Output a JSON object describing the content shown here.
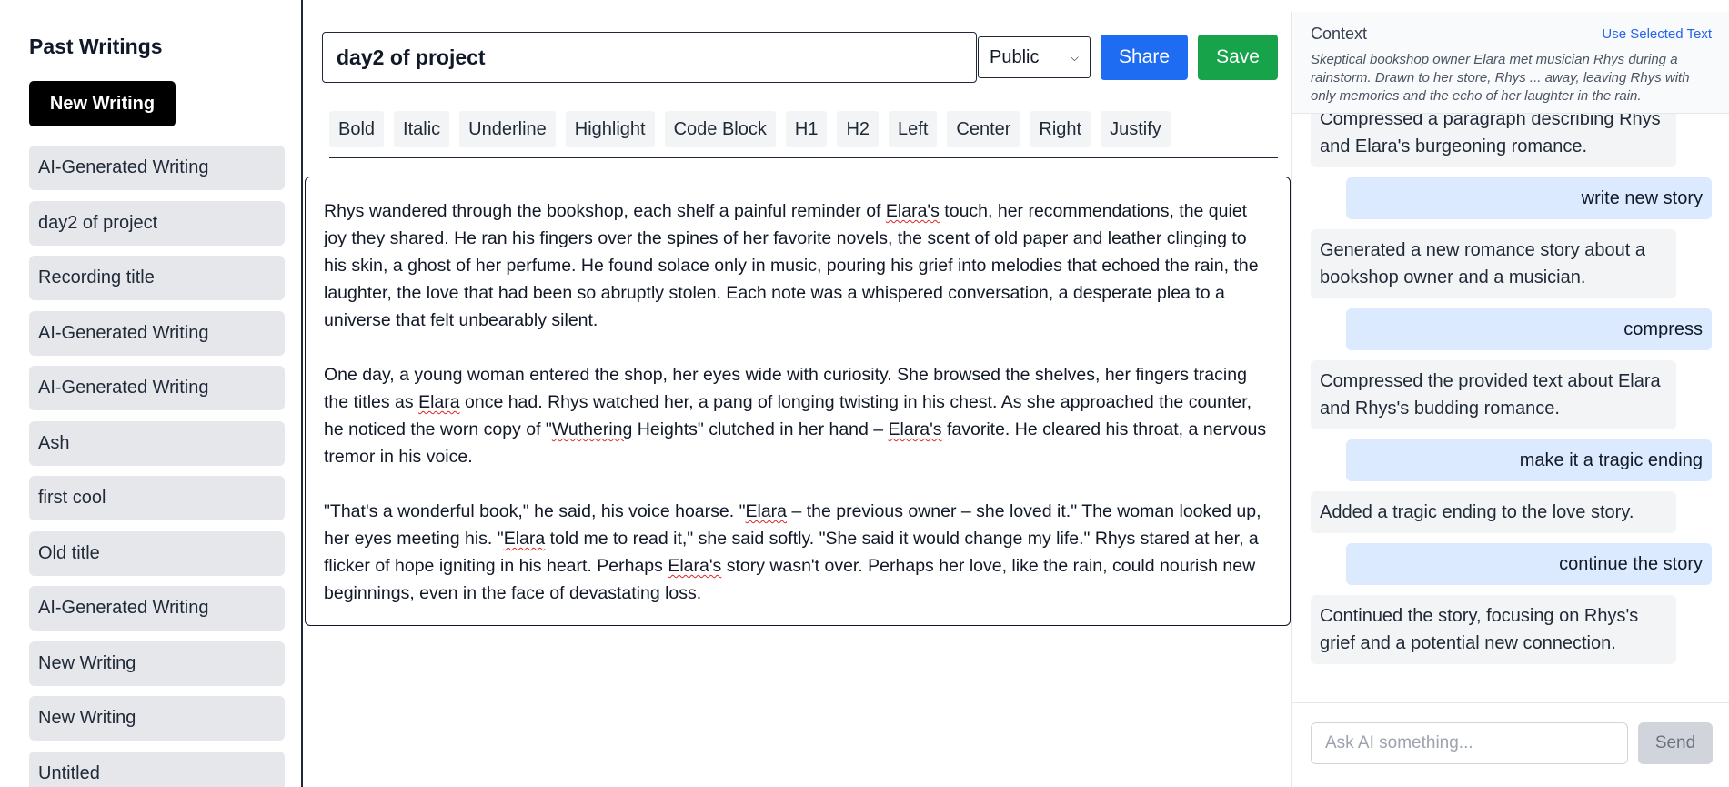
{
  "sidebar": {
    "title": "Past Writings",
    "new_button": "New Writing",
    "items": [
      {
        "label": "AI-Generated Writing"
      },
      {
        "label": "day2 of project"
      },
      {
        "label": "Recording title"
      },
      {
        "label": "AI-Generated Writing"
      },
      {
        "label": "AI-Generated Writing"
      },
      {
        "label": "Ash"
      },
      {
        "label": "first cool"
      },
      {
        "label": "Old title"
      },
      {
        "label": "AI-Generated Writing"
      },
      {
        "label": "New Writing"
      },
      {
        "label": "New Writing"
      },
      {
        "label": "Untitled"
      }
    ]
  },
  "editor": {
    "title_value": "day2 of project",
    "visibility": "Public",
    "share_label": "Share",
    "save_label": "Save",
    "toolbar": [
      "Bold",
      "Italic",
      "Underline",
      "Highlight",
      "Code Block",
      "H1",
      "H2",
      "Left",
      "Center",
      "Right",
      "Justify"
    ],
    "paragraphs": [
      [
        {
          "t": "Rhys wandered through the bookshop, each shelf a painful reminder of "
        },
        {
          "t": "Elara's",
          "s": true
        },
        {
          "t": " touch, her recommendations, the quiet joy they shared. He ran his fingers over the spines of her favorite novels, the scent of old paper and leather clinging to his skin, a ghost of her perfume. He found solace only in music, pouring his grief into melodies that echoed the rain, the laughter, the love that had been so abruptly stolen. Each note was a whispered conversation, a desperate plea to a universe that felt unbearably silent."
        }
      ],
      [
        {
          "t": "One day, a young woman entered the shop, her eyes wide with curiosity. She browsed the shelves, her fingers tracing the titles as "
        },
        {
          "t": "Elara",
          "s": true
        },
        {
          "t": " once had. Rhys watched her, a pang of longing twisting in his chest. As she approached the counter, he noticed the worn copy of \""
        },
        {
          "t": "Wuthering",
          "s": true
        },
        {
          "t": " Heights\" clutched in her hand – "
        },
        {
          "t": "Elara's",
          "s": true
        },
        {
          "t": " favorite. He cleared his throat, a nervous tremor in his voice."
        }
      ],
      [
        {
          "t": "\"That's a wonderful book,\" he said, his voice hoarse. \""
        },
        {
          "t": "Elara",
          "s": true
        },
        {
          "t": " – the previous owner – she loved it.\" The woman looked up, her eyes meeting his. \""
        },
        {
          "t": "Elara",
          "s": true
        },
        {
          "t": " told me to read it,\" she said softly. \"She said it would change my life.\" Rhys stared at her, a flicker of hope igniting in his heart. Perhaps "
        },
        {
          "t": "Elara's",
          "s": true
        },
        {
          "t": " story wasn't over. Perhaps her love, like the rain, could nourish new beginnings, even in the face of devastating loss."
        }
      ]
    ]
  },
  "chat": {
    "context_title": "Context",
    "use_selected_label": "Use Selected Text",
    "context_text": "Skeptical bookshop owner Elara met musician Rhys during a rainstorm. Drawn to her store, Rhys ... away, leaving Rhys with only memories and the echo of her laughter in the rain.",
    "messages": [
      {
        "role": "ai",
        "text": "Compressed a paragraph describing Rhys and Elara's burgeoning romance."
      },
      {
        "role": "user",
        "text": "write new story"
      },
      {
        "role": "ai",
        "text": "Generated a new romance story about a bookshop owner and a musician."
      },
      {
        "role": "user",
        "text": "compress"
      },
      {
        "role": "ai",
        "text": "Compressed the provided text about Elara and Rhys's budding romance."
      },
      {
        "role": "user",
        "text": "make it a tragic ending"
      },
      {
        "role": "ai",
        "text": "Added a tragic ending to the love story."
      },
      {
        "role": "user",
        "text": "continue the story"
      },
      {
        "role": "ai",
        "text": "Continued the story, focusing on Rhys's grief and a potential new connection."
      }
    ],
    "input_placeholder": "Ask AI something...",
    "send_label": "Send"
  }
}
